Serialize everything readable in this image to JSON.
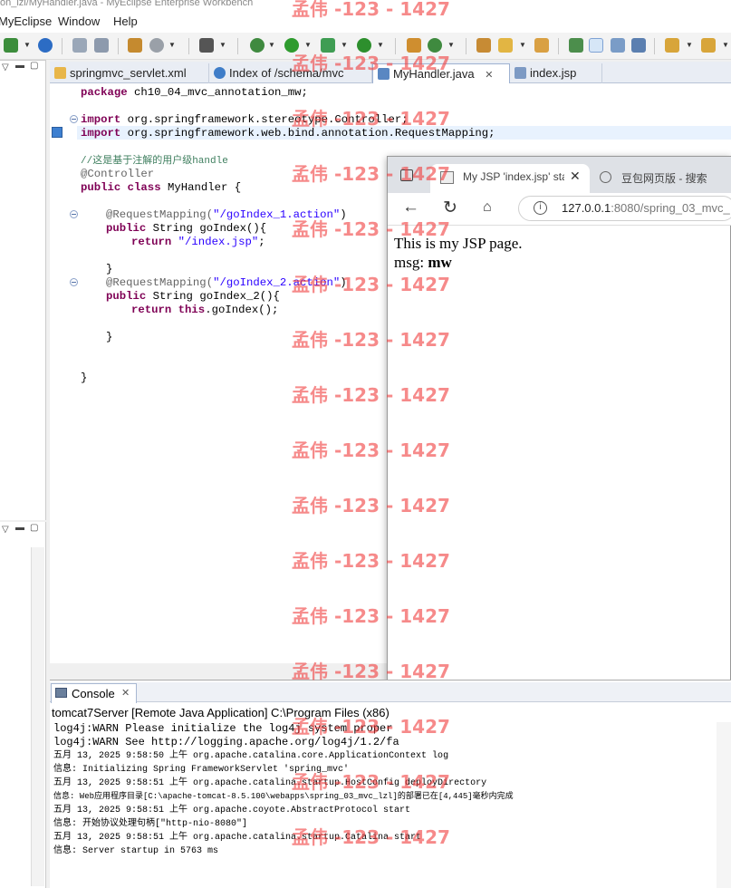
{
  "window_title": "on_lzl/MyHandler.java - MyEclipse Enterprise Workbench",
  "menu": [
    "MyEclipse",
    "Window",
    "Help"
  ],
  "editor_tabs": [
    {
      "label": "springmvc_servlet.xml",
      "icon": "xml-file-icon"
    },
    {
      "label": "Index of /schema/mvc",
      "icon": "globe-icon"
    },
    {
      "label": "MyHandler.java",
      "icon": "java-file-icon",
      "active": true
    },
    {
      "label": "index.jsp",
      "icon": "jsp-file-icon"
    }
  ],
  "code": {
    "l1_kw": "package",
    "l1_rest": " ch10_04_mvc_annotation_mw;",
    "l2_kw": "import",
    "l2_rest": " org.springframework.stereotype.Controller;",
    "l3_kw": "import",
    "l3_rest": " org.springframework.web.bind.annotation.RequestMapping;",
    "l4": "//这是基于注解的用户级handle",
    "l5": "@Controller",
    "l6_kw1": "public",
    "l6_kw2": "class",
    "l6_rest": " MyHandler {",
    "l7_ann": "@RequestMapping(",
    "l7_str": "\"/goIndex_1.action\"",
    "l7_end": ")",
    "l8_kw": "public",
    "l8_rest": " String goIndex(){",
    "l9_kw": "return",
    "l9_str": "\"/index.jsp\"",
    "l9_end": ";",
    "l10": "}",
    "l11_ann": "@RequestMapping(",
    "l11_str": "\"/goIndex_2.action\"",
    "l11_end": ")",
    "l12_kw": "public",
    "l12_rest": " String goIndex_2(){",
    "l13_kw1": "return",
    "l13_kw2": "this",
    "l13_rest": ".goIndex();",
    "l14": "}",
    "l15": "}"
  },
  "browser": {
    "tab1_title": "My JSP 'index.jsp' sta",
    "tab2_title": "豆包网页版 - 搜索",
    "url_host": "127.0.0.1",
    "url_rest": ":8080/spring_03_mvc_",
    "page_line1": "This is my JSP page.",
    "page_line2_label": "msg: ",
    "page_line2_value": "mw"
  },
  "console": {
    "tab_label": "Console",
    "description": "tomcat7Server [Remote Java Application] C:\\Program Files (x86)",
    "lines": [
      "log4j:WARN Please initialize the log4j system proper",
      "log4j:WARN See http://logging.apache.org/log4j/1.2/fa",
      "五月 13, 2025 9:58:50 上午 org.apache.catalina.core.ApplicationContext log",
      "信息: Initializing Spring FrameworkServlet 'spring_mvc'",
      "五月 13, 2025 9:58:51 上午 org.apache.catalina.startup.HostConfig deployDirectory",
      "信息: Web应用程序目录[C:\\apache-tomcat-8.5.100\\webapps\\spring_03_mvc_lzl]的部署已在[4,445]毫秒内完成",
      "五月 13, 2025 9:58:51 上午 org.apache.coyote.AbstractProtocol start",
      "信息: 开始协议处理句柄[\"http-nio-8080\"]",
      "五月 13, 2025 9:58:51 上午 org.apache.catalina.startup.Catalina start",
      "信息: Server startup in 5763 ms"
    ]
  },
  "watermark": "孟伟 -123 - 1427"
}
